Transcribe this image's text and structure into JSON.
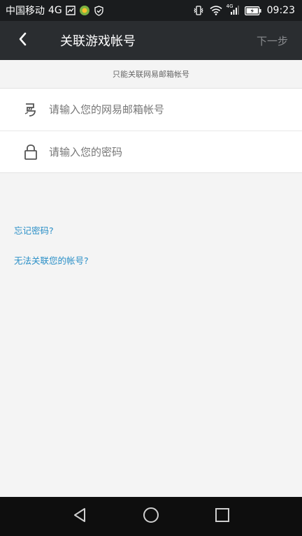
{
  "status_bar": {
    "carrier": "中国移动",
    "network": "4G",
    "network_small": "4G",
    "time": "09:23"
  },
  "header": {
    "title": "关联游戏帐号",
    "next_label": "下一步"
  },
  "hint": "只能关联网易邮箱帐号",
  "form": {
    "email_placeholder": "请输入您的网易邮箱帐号",
    "password_placeholder": "请输入您的密码"
  },
  "links": {
    "forgot_password": "忘记密码?",
    "cannot_link": "无法关联您的帐号?"
  },
  "icons": {
    "back": "back-arrow-icon",
    "email": "netease-logo-icon",
    "password": "lock-icon",
    "nav_back": "nav-back-triangle-icon",
    "nav_home": "nav-home-circle-icon",
    "nav_recent": "nav-recent-square-icon"
  },
  "colors": {
    "header_bg": "#2a2d30",
    "status_bg": "#1a1c1e",
    "link": "#2a8fc7",
    "next_disabled": "#8a8c8f",
    "page_bg": "#f4f4f4"
  }
}
